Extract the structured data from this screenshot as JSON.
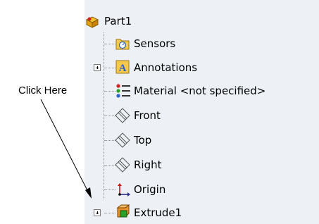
{
  "tree": {
    "root": {
      "label": "Part1",
      "icon": "part-icon"
    },
    "items": [
      {
        "label": "Sensors",
        "icon": "sensors-folder-icon",
        "expandable": false
      },
      {
        "label": "Annotations",
        "icon": "annotations-icon",
        "expandable": true
      },
      {
        "label": "Material <not specified>",
        "icon": "material-icon",
        "expandable": false
      },
      {
        "label": "Front",
        "icon": "plane-icon",
        "expandable": false
      },
      {
        "label": "Top",
        "icon": "plane-icon",
        "expandable": false
      },
      {
        "label": "Right",
        "icon": "plane-icon",
        "expandable": false
      },
      {
        "label": "Origin",
        "icon": "origin-icon",
        "expandable": false
      },
      {
        "label": "Extrude1",
        "icon": "extrude-feature-icon",
        "expandable": true
      }
    ]
  },
  "callout": {
    "label": "Click Here"
  },
  "colors": {
    "panel_bg": "#edf1f6",
    "folder_yellow": "#f6c94a",
    "annotation_blue": "#2a62c9",
    "extrude_orange": "#e8912a"
  }
}
